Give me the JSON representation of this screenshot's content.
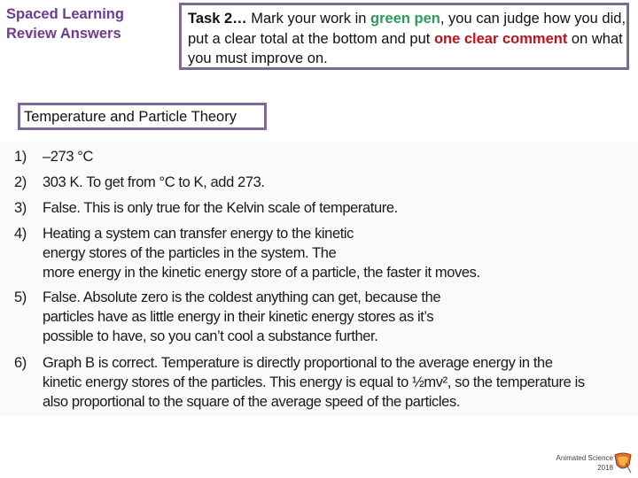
{
  "header": {
    "title_line1": "Spaced Learning",
    "title_line2": "Review Answers"
  },
  "task": {
    "prefix": "Task 2…",
    "text1": " Mark your work in ",
    "green": "green pen",
    "text2": ", you can judge how you did, put a clear total at the bottom and put ",
    "red": "one clear comment",
    "text3": " on what you must improve on."
  },
  "section_title": "Temperature and Particle Theory",
  "answers": [
    {
      "num": "1)",
      "lines": [
        "–273 °C"
      ]
    },
    {
      "num": "2)",
      "lines": [
        "303 K.  To get from °C to K, add 273."
      ]
    },
    {
      "num": "3)",
      "lines": [
        "False.  This is only true for the Kelvin scale of temperature."
      ]
    },
    {
      "num": "4)",
      "lines": [
        "Heating a system can transfer energy to the kinetic",
        "energy stores of the particles in the system.  The",
        "more energy in the kinetic energy store of a particle, the faster it moves."
      ]
    },
    {
      "num": "5)",
      "lines": [
        "False.  Absolute zero is the coldest anything can get, because the",
        "particles have as little energy in their kinetic energy stores as it’s",
        "possible to have, so you can’t cool a substance further."
      ]
    },
    {
      "num": "6)",
      "lines": [
        "Graph B is correct.  Temperature is directly proportional to the average energy in the",
        "kinetic energy stores of the particles.  This energy is equal to ½mv², so the temperature is",
        "also proportional to the square of the average speed of the particles."
      ]
    }
  ],
  "footer": {
    "credit_line1": "Animated Science",
    "credit_line2": "2018",
    "logo_icon": "shield-logo-icon"
  },
  "colors": {
    "title": "#6a3d8f",
    "border": "#7c6a95",
    "green": "#2e9a5a",
    "red": "#c0121a"
  }
}
